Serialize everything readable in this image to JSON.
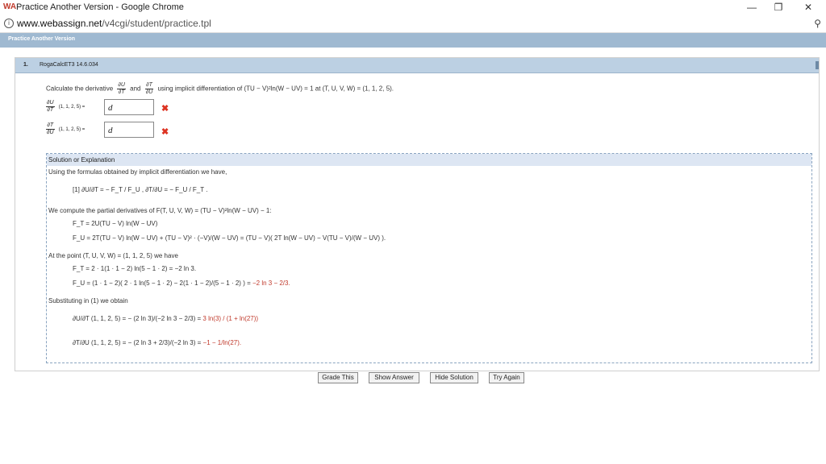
{
  "window": {
    "title": "Practice Another Version - Google Chrome",
    "logo": "WA",
    "minimize": "—",
    "restore": "❐",
    "close": "✕"
  },
  "address": {
    "domain": "www.webassign.net",
    "path": "/v4cgi/student/practice.tpl",
    "info_icon": "i",
    "zoom_icon": "⚲"
  },
  "page": {
    "heading": "Practice Another Version"
  },
  "question": {
    "number": "1.",
    "reference": "RogaCalcET3 14.6.034",
    "prompt_start": "Calculate the derivative",
    "frac1_n": "∂U",
    "frac1_d": "∂T",
    "and": "and",
    "frac2_n": "∂T",
    "frac2_d": "∂U",
    "prompt_end": "using implicit differentiation of  (TU − V)²ln(W − UV) = 1  at  (T, U, V, W) = (1, 1, 2, 5).",
    "ans1_label": "(1, 1, 2, 5) =",
    "ans1_value": "d",
    "ans2_label": "(1, 1, 2, 5) =",
    "ans2_value": "d",
    "wrong_mark": "✖"
  },
  "solution": {
    "header": "Solution or Explanation",
    "l1": "Using the formulas obtained by implicit differentiation we have,",
    "l2": "[1]   ∂U/∂T  =  − F_T / F_U ,    ∂T/∂U  =  − F_U / F_T .",
    "l3": "We compute the partial derivatives of  F(T, U, V, W) = (TU − V)²ln(W − UV) − 1:",
    "l4": "F_T = 2U(TU − V) ln(W − UV)",
    "l5": "F_U = 2T(TU − V) ln(W − UV) + (TU − V)² · (−V)/(W − UV)  =  (TU − V)( 2T ln(W − UV) − V(TU − V)/(W − UV) ).",
    "l6": "At the point  (T, U, V, W) = (1, 1, 2, 5)  we have",
    "l7": "F_T = 2 · 1(1 · 1 − 2) ln(5 − 1 · 2) = −2 ln 3.",
    "l8a": "F_U = (1 · 1 − 2)( 2 · 1 ln(5 − 1 · 2) − 2(1 · 1 − 2)/(5 − 1 · 2) )  =  ",
    "l8b": "−2 ln 3 − 2/3.",
    "l9": "Substituting in (1) we obtain",
    "l10a": "∂U/∂T (1, 1, 2, 5) = − (2 ln 3)/(−2 ln 3 − 2/3)  =  ",
    "l10b": "3 ln(3) / (1 + ln(27))",
    "l11a": "∂T/∂U (1, 1, 2, 5) = − (2 ln 3 + 2/3)/(−2 ln 3)  =  ",
    "l11b": "−1 − 1/ln(27)."
  },
  "buttons": {
    "grade": "Grade This",
    "show": "Show Answer",
    "hide": "Hide Solution",
    "try": "Try Again"
  }
}
